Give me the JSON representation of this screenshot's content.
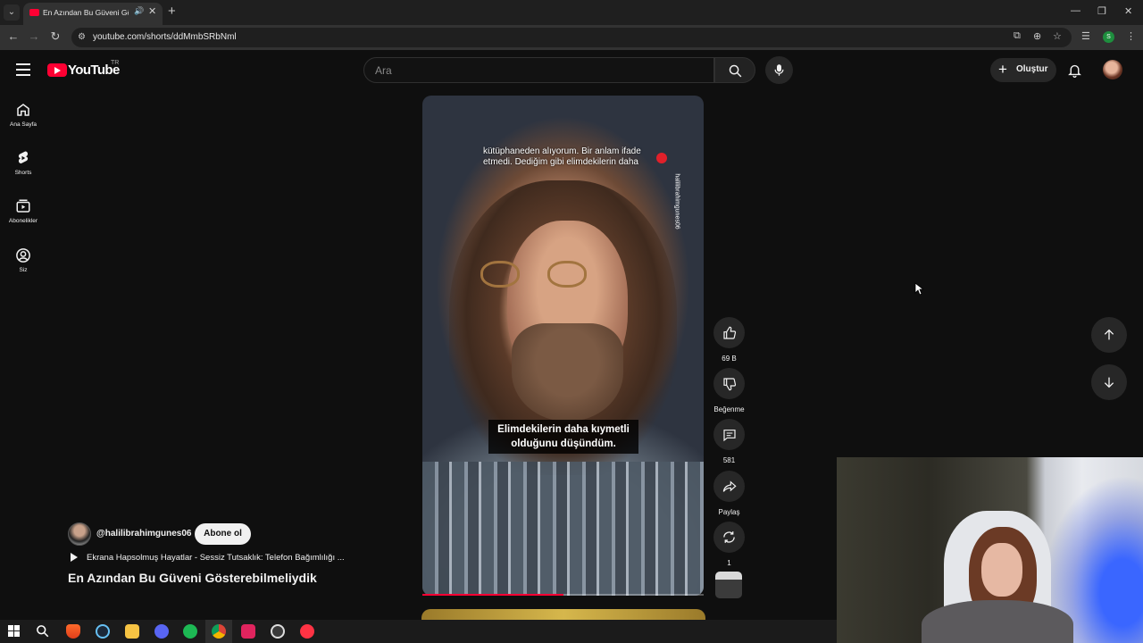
{
  "browser": {
    "tab_title": "En Azından Bu Güveni Göst",
    "url": "youtube.com/shorts/ddMmbSRbNml",
    "new_tab_symbol": "+",
    "profile_initial": "S"
  },
  "header": {
    "logo_text": "YouTube",
    "country_code": "TR",
    "search_placeholder": "Ara",
    "create_label": "Oluştur"
  },
  "sidebar": {
    "items": [
      {
        "label": "Ana Sayfa",
        "icon": "home-icon"
      },
      {
        "label": "Shorts",
        "icon": "shorts-icon"
      },
      {
        "label": "Abonelikler",
        "icon": "subscriptions-icon"
      },
      {
        "label": "Siz",
        "icon": "you-icon"
      }
    ]
  },
  "video": {
    "caption_top": "kütüphaneden alıyorum. Bir anlam ifade etmedi. Dediğim gibi elimdekilerin daha",
    "caption_main": "Elimdekilerin daha kıymetli olduğunu düşündüm.",
    "watermark": "halilibrahimgunes06",
    "progress": 0.5
  },
  "actions": {
    "likes": "69 B",
    "dislike_label": "Beğenme",
    "comments": "581",
    "share_label": "Paylaş",
    "remix_count": "1"
  },
  "channel": {
    "handle": "@halilibrahimgunes06",
    "subscribe_label": "Abone ol",
    "playlist": "Ekrana Hapsolmuş Hayatlar - Sessiz Tutsaklık: Telefon Bağımlılığı ...",
    "title": "En Azından Bu Güveni Gösterebilmeliydik"
  },
  "colors": {
    "brand_red": "#ff0033",
    "background": "#0f0f0f",
    "chip": "#272727"
  },
  "taskbar": {
    "apps": [
      "windows-start-icon",
      "search-icon",
      "brave-icon",
      "steam-icon",
      "file-explorer-icon",
      "discord-icon",
      "spotify-icon",
      "chrome-icon",
      "app-red-icon",
      "clock-app-icon",
      "app-bubble-icon"
    ]
  }
}
